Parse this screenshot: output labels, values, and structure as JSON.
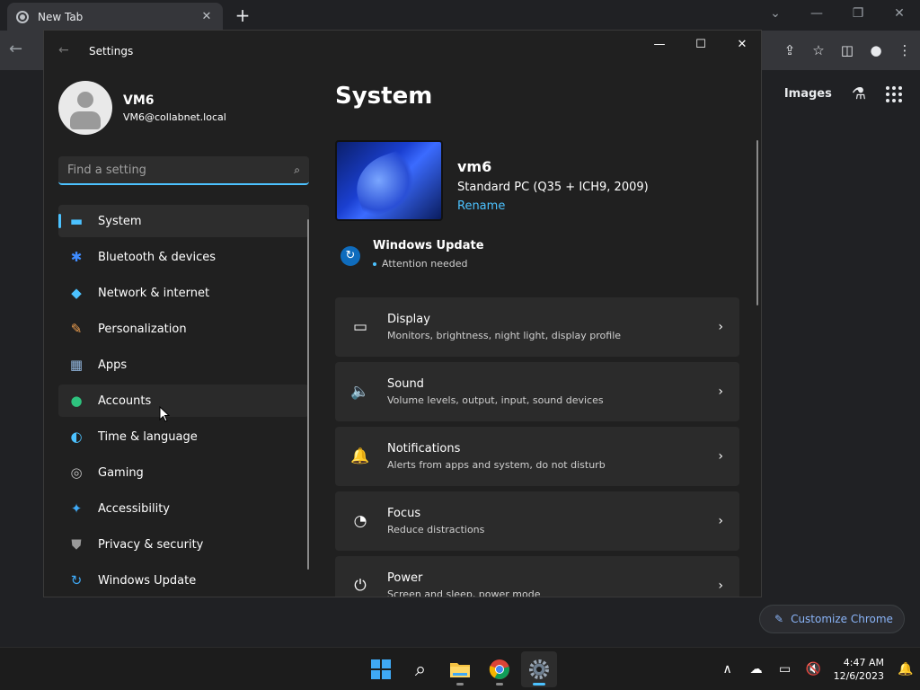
{
  "chrome": {
    "tab_title": "New Tab",
    "tab_close": "✕",
    "new_tab": "+",
    "window_controls": [
      "⌄",
      "—",
      "❐",
      "✕"
    ],
    "back": "←",
    "toolbar_icons": [
      "⇪",
      "☆",
      "◫",
      "●",
      "⋮"
    ],
    "ntp_images": "Images",
    "ntp_labs_icon": "flask-icon",
    "customize_chrome": "Customize Chrome",
    "customize_icon": "✎"
  },
  "settings": {
    "window_title": "Settings",
    "back": "←",
    "window_controls": [
      "—",
      "☐",
      "✕"
    ],
    "profile": {
      "name": "VM6",
      "email": "VM6@collabnet.local"
    },
    "search": {
      "placeholder": "Find a setting",
      "icon": "⌕"
    },
    "nav": [
      {
        "label": "System",
        "icon": "▬",
        "color": "#4cc2ff",
        "selected": true
      },
      {
        "label": "Bluetooth & devices",
        "icon": "✱",
        "color": "#3f8cff"
      },
      {
        "label": "Network & internet",
        "icon": "◆",
        "color": "#4cc2ff"
      },
      {
        "label": "Personalization",
        "icon": "✎",
        "color": "#f0a050"
      },
      {
        "label": "Apps",
        "icon": "▦",
        "color": "#8fb3d9"
      },
      {
        "label": "Accounts",
        "icon": "●",
        "color": "#2ec27e",
        "hover": true
      },
      {
        "label": "Time & language",
        "icon": "◐",
        "color": "#4cc2ff"
      },
      {
        "label": "Gaming",
        "icon": "◎",
        "color": "#bfbfbf"
      },
      {
        "label": "Accessibility",
        "icon": "✦",
        "color": "#3fa9f5"
      },
      {
        "label": "Privacy & security",
        "icon": "⛊",
        "color": "#9a9a9a"
      },
      {
        "label": "Windows Update",
        "icon": "↻",
        "color": "#3fa9f5"
      }
    ],
    "page_title": "System",
    "device": {
      "name": "vm6",
      "model": "Standard PC (Q35 + ICH9, 2009)",
      "rename": "Rename"
    },
    "windows_update": {
      "title": "Windows Update",
      "status": "Attention needed",
      "icon": "↻"
    },
    "cards": [
      {
        "title": "Display",
        "desc": "Monitors, brightness, night light, display profile",
        "icon": "▭"
      },
      {
        "title": "Sound",
        "desc": "Volume levels, output, input, sound devices",
        "icon": "🔈"
      },
      {
        "title": "Notifications",
        "desc": "Alerts from apps and system, do not disturb",
        "icon": "🔔"
      },
      {
        "title": "Focus",
        "desc": "Reduce distractions",
        "icon": "◔"
      },
      {
        "title": "Power",
        "desc": "Screen and sleep, power mode",
        "icon": "⏻"
      }
    ],
    "chevron": "›"
  },
  "taskbar": {
    "apps": [
      "Start",
      "Search",
      "File Explorer",
      "Google Chrome",
      "Settings"
    ],
    "search_icon": "⌕",
    "tray": {
      "chevron": "∧",
      "cloud": "☁",
      "display": "▭",
      "volume": "🔇",
      "bell": "🔔"
    },
    "time": "4:47 AM",
    "date": "12/6/2023"
  }
}
